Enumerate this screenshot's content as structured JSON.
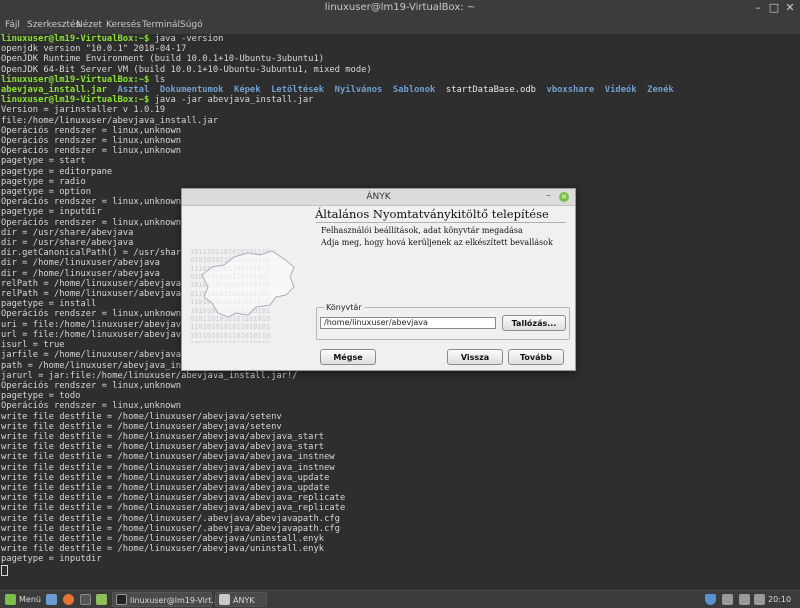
{
  "terminal": {
    "title": "linuxuser@lm19-VirtualBox: ~",
    "menu": [
      "Fájl",
      "Szerkesztés",
      "Nézet",
      "Keresés",
      "Terminál",
      "Súgó"
    ],
    "prompt": "linuxuser@lm19-VirtualBox:~$",
    "cmd1": " java -version",
    "out1": "openjdk version \"10.0.1\" 2018-04-17\nOpenJDK Runtime Environment (build 10.0.1+10-Ubuntu-3ubuntu1)\nOpenJDK 64-Bit Server VM (build 10.0.1+10-Ubuntu-3ubuntu1, mixed mode)",
    "cmd2": " ls",
    "ls_jar": "abevjava_install.jar",
    "ls_dirs1": "Asztal  Dokumentumok  Képek  Letöltések  Nyilvános  Sablonok",
    "ls_file": "startDataBase.odb",
    "ls_dirs2": "vboxshare  Videók  Zenék",
    "cmd3": " java -jar abevjava_install.jar",
    "out3": "Version = jarinstaller v 1.0.19\nfile:/home/linuxuser/abevjava_install.jar\nOperációs rendszer = linux,unknown\nOperációs rendszer = linux,unknown\nOperációs rendszer = linux,unknown\npagetype = start\npagetype = editorpane\npagetype = radio\npagetype = option\nOperációs rendszer = linux,unknown\npagetype = inputdir\nOperációs rendszer = linux,unknown\ndir = /usr/share/abevjava\ndir = /usr/share/abevjava\ndir.getCanonicalPath() = /usr/share/abevjava\ndir = /home/linuxuser/abevjava\ndir = /home/linuxuser/abevjava\nrelPath = /home/linuxuser/abevjava\nrelPath = /home/linuxuser/abevjava\npagetype = install\nOperációs rendszer = linux,unknown\nuri = file:/home/linuxuser/abevjava_install.jar\nurl = file:/home/linuxuser/abevjava_install.jar\nisurl = true\njarfile = /home/linuxuser/abevjava_install.jar\npath = /home/linuxuser/abevjava_install.jar\njarurl = jar:file:/home/linuxuser/abevjava_install.jar!/\nOperációs rendszer = linux,unknown\npagetype = todo\nOperációs rendszer = linux,unknown\nwrite file destfile = /home/linuxuser/abevjava/setenv\nwrite file destfile = /home/linuxuser/abevjava/setenv\nwrite file destfile = /home/linuxuser/abevjava/abevjava_start\nwrite file destfile = /home/linuxuser/abevjava/abevjava_start\nwrite file destfile = /home/linuxuser/abevjava/abevjava_instnew\nwrite file destfile = /home/linuxuser/abevjava/abevjava_instnew\nwrite file destfile = /home/linuxuser/abevjava/abevjava_update\nwrite file destfile = /home/linuxuser/abevjava/abevjava_update\nwrite file destfile = /home/linuxuser/abevjava/abevjava_replicate\nwrite file destfile = /home/linuxuser/abevjava/abevjava_replicate\nwrite file destfile = /home/linuxuser/.abevjava/abevjavapath.cfg\nwrite file destfile = /home/linuxuser/.abevjava/abevjavapath.cfg\nwrite file destfile = /home/linuxuser/abevjava/uninstall.enyk\nwrite file destfile = /home/linuxuser/abevjava/uninstall.enyk\npagetype = inputdir"
  },
  "dialog": {
    "title": "ÁNYK",
    "heading": "Általános Nyomtatványkitöltő telepítése",
    "line1": "Felhasználói beállítások, adat könyvtár megadása",
    "line2": "Adja meg, hogy hová kerüljenek az elkészített bevallások",
    "art_digits": "1011101101010101110\n0101010110110000110\n1110101001100101011\n0101011010110101001\n1010110101010110110\n0110101011010101101\n1101010110101011010\n1010101101010110101\n0101101010101101010\n1101010101011010101\n1011010101101010110\n1001011101011010010",
    "folder_legend": "Könyvtár",
    "folder_value": "/home/linuxuser/abevjava",
    "browse_label": "Tallózás...",
    "cancel_label": "Mégse",
    "back_label": "Vissza",
    "next_label": "Tovább"
  },
  "taskbar": {
    "menu_label": "Menü",
    "window1": "linuxuser@lm19-Virt...",
    "window2": "ÁNYK",
    "clock": "20:10"
  },
  "colors": {
    "prompt_green": "#8ae234",
    "dir_blue": "#729fcf",
    "terminal_bg": "#2e2e2e",
    "mint_green": "#7bbf4a"
  }
}
